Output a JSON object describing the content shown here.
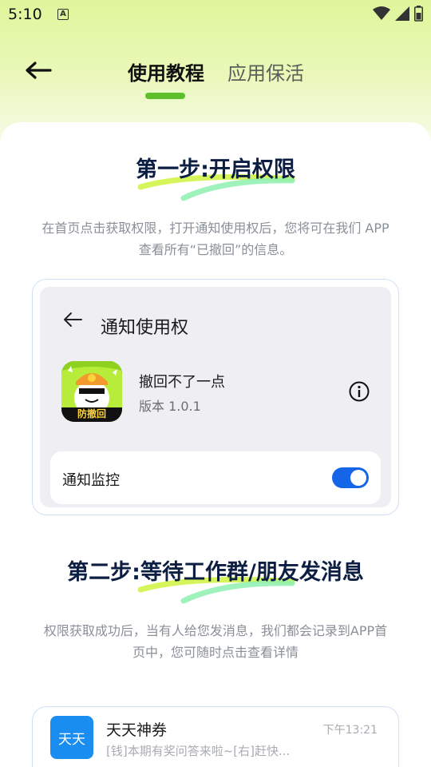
{
  "status_bar": {
    "time": "5:10",
    "a_icon": "A"
  },
  "header": {
    "tabs": [
      {
        "label": "使用教程",
        "active": true
      },
      {
        "label": "应用保活",
        "active": false
      }
    ]
  },
  "step1": {
    "title": "第一步:开启权限",
    "description": "在首页点击获取权限，打开通知使用权后，您将可在我们 APP查看所有“已撤回”的信息。"
  },
  "permission_demo": {
    "title": "通知使用权",
    "app_name": "撤回不了一点",
    "app_version": "版本 1.0.1",
    "app_icon_caption": "防撤回",
    "toggle_label": "通知监控",
    "toggle_on": true
  },
  "step2": {
    "title": "第二步:等待工作群/朋友发消息",
    "description": "权限获取成功后，当有人给您发消息，我们都会记录到APP首页中，您可随时点击查看详情"
  },
  "message_demo": {
    "avatar_text": "天天",
    "name": "天天神券",
    "time": "下午13:21",
    "preview": "[钱]本期有奖问答来啦~[右]赶快..."
  },
  "colors": {
    "accent_green": "#5fbf2b",
    "title_navy": "#0c1e42",
    "toggle_blue": "#1565e8",
    "avatar_blue": "#1a8df0"
  }
}
